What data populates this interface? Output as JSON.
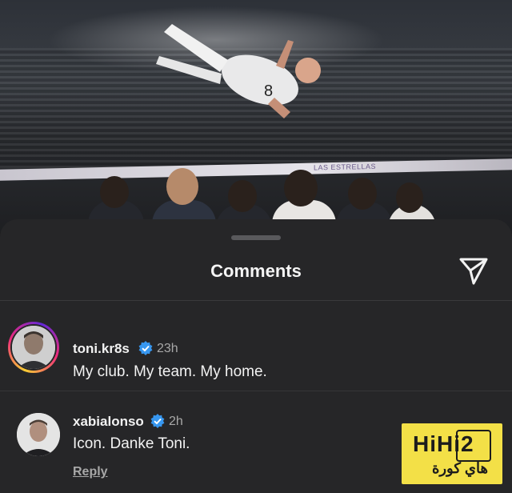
{
  "sheet": {
    "title": "Comments"
  },
  "banner_text": "LAS ESTRELLAS",
  "comments": [
    {
      "username": "toni.kr8s",
      "verified": true,
      "time": "23h",
      "text": "My club. My team. My home.",
      "story_ring": true
    },
    {
      "username": "xabialonso",
      "verified": true,
      "time": "2h",
      "text": "Icon. Danke Toni.",
      "reply_label": "Reply"
    }
  ],
  "watermark": {
    "line1": "HiHi2",
    "line2": "هاي كورة"
  },
  "colors": {
    "sheet_bg": "#262628",
    "verified_blue": "#3797f0",
    "muted_text": "#a8a8a8",
    "watermark_yellow": "#f3e047"
  },
  "icons": {
    "share": "paper-plane-icon",
    "verified": "verified-badge-icon"
  }
}
